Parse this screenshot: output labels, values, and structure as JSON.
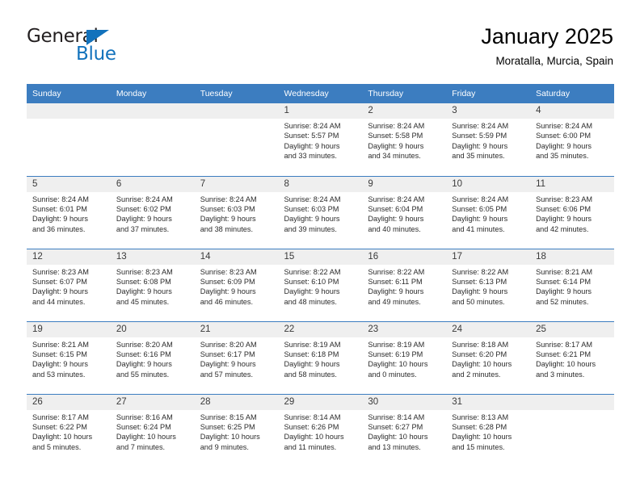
{
  "brand": {
    "name_part1": "General",
    "name_part2": "Blue",
    "logo_icon": "triangle-flag-icon",
    "accent_color": "#1272bc"
  },
  "header": {
    "title": "January 2025",
    "subtitle": "Moratalla, Murcia, Spain"
  },
  "colors": {
    "header_blue": "#3c7dc0",
    "daynum_band": "#efefef",
    "text": "#2b2b2b"
  },
  "calendar": {
    "weekday_headers": [
      "Sunday",
      "Monday",
      "Tuesday",
      "Wednesday",
      "Thursday",
      "Friday",
      "Saturday"
    ],
    "weeks": [
      [
        {
          "day": "",
          "sunrise": "",
          "sunset": "",
          "daylight1": "",
          "daylight2": "",
          "empty": true
        },
        {
          "day": "",
          "sunrise": "",
          "sunset": "",
          "daylight1": "",
          "daylight2": "",
          "empty": true
        },
        {
          "day": "",
          "sunrise": "",
          "sunset": "",
          "daylight1": "",
          "daylight2": "",
          "empty": true
        },
        {
          "day": "1",
          "sunrise": "Sunrise: 8:24 AM",
          "sunset": "Sunset: 5:57 PM",
          "daylight1": "Daylight: 9 hours",
          "daylight2": "and 33 minutes."
        },
        {
          "day": "2",
          "sunrise": "Sunrise: 8:24 AM",
          "sunset": "Sunset: 5:58 PM",
          "daylight1": "Daylight: 9 hours",
          "daylight2": "and 34 minutes."
        },
        {
          "day": "3",
          "sunrise": "Sunrise: 8:24 AM",
          "sunset": "Sunset: 5:59 PM",
          "daylight1": "Daylight: 9 hours",
          "daylight2": "and 35 minutes."
        },
        {
          "day": "4",
          "sunrise": "Sunrise: 8:24 AM",
          "sunset": "Sunset: 6:00 PM",
          "daylight1": "Daylight: 9 hours",
          "daylight2": "and 35 minutes."
        }
      ],
      [
        {
          "day": "5",
          "sunrise": "Sunrise: 8:24 AM",
          "sunset": "Sunset: 6:01 PM",
          "daylight1": "Daylight: 9 hours",
          "daylight2": "and 36 minutes."
        },
        {
          "day": "6",
          "sunrise": "Sunrise: 8:24 AM",
          "sunset": "Sunset: 6:02 PM",
          "daylight1": "Daylight: 9 hours",
          "daylight2": "and 37 minutes."
        },
        {
          "day": "7",
          "sunrise": "Sunrise: 8:24 AM",
          "sunset": "Sunset: 6:03 PM",
          "daylight1": "Daylight: 9 hours",
          "daylight2": "and 38 minutes."
        },
        {
          "day": "8",
          "sunrise": "Sunrise: 8:24 AM",
          "sunset": "Sunset: 6:03 PM",
          "daylight1": "Daylight: 9 hours",
          "daylight2": "and 39 minutes."
        },
        {
          "day": "9",
          "sunrise": "Sunrise: 8:24 AM",
          "sunset": "Sunset: 6:04 PM",
          "daylight1": "Daylight: 9 hours",
          "daylight2": "and 40 minutes."
        },
        {
          "day": "10",
          "sunrise": "Sunrise: 8:24 AM",
          "sunset": "Sunset: 6:05 PM",
          "daylight1": "Daylight: 9 hours",
          "daylight2": "and 41 minutes."
        },
        {
          "day": "11",
          "sunrise": "Sunrise: 8:23 AM",
          "sunset": "Sunset: 6:06 PM",
          "daylight1": "Daylight: 9 hours",
          "daylight2": "and 42 minutes."
        }
      ],
      [
        {
          "day": "12",
          "sunrise": "Sunrise: 8:23 AM",
          "sunset": "Sunset: 6:07 PM",
          "daylight1": "Daylight: 9 hours",
          "daylight2": "and 44 minutes."
        },
        {
          "day": "13",
          "sunrise": "Sunrise: 8:23 AM",
          "sunset": "Sunset: 6:08 PM",
          "daylight1": "Daylight: 9 hours",
          "daylight2": "and 45 minutes."
        },
        {
          "day": "14",
          "sunrise": "Sunrise: 8:23 AM",
          "sunset": "Sunset: 6:09 PM",
          "daylight1": "Daylight: 9 hours",
          "daylight2": "and 46 minutes."
        },
        {
          "day": "15",
          "sunrise": "Sunrise: 8:22 AM",
          "sunset": "Sunset: 6:10 PM",
          "daylight1": "Daylight: 9 hours",
          "daylight2": "and 48 minutes."
        },
        {
          "day": "16",
          "sunrise": "Sunrise: 8:22 AM",
          "sunset": "Sunset: 6:11 PM",
          "daylight1": "Daylight: 9 hours",
          "daylight2": "and 49 minutes."
        },
        {
          "day": "17",
          "sunrise": "Sunrise: 8:22 AM",
          "sunset": "Sunset: 6:13 PM",
          "daylight1": "Daylight: 9 hours",
          "daylight2": "and 50 minutes."
        },
        {
          "day": "18",
          "sunrise": "Sunrise: 8:21 AM",
          "sunset": "Sunset: 6:14 PM",
          "daylight1": "Daylight: 9 hours",
          "daylight2": "and 52 minutes."
        }
      ],
      [
        {
          "day": "19",
          "sunrise": "Sunrise: 8:21 AM",
          "sunset": "Sunset: 6:15 PM",
          "daylight1": "Daylight: 9 hours",
          "daylight2": "and 53 minutes."
        },
        {
          "day": "20",
          "sunrise": "Sunrise: 8:20 AM",
          "sunset": "Sunset: 6:16 PM",
          "daylight1": "Daylight: 9 hours",
          "daylight2": "and 55 minutes."
        },
        {
          "day": "21",
          "sunrise": "Sunrise: 8:20 AM",
          "sunset": "Sunset: 6:17 PM",
          "daylight1": "Daylight: 9 hours",
          "daylight2": "and 57 minutes."
        },
        {
          "day": "22",
          "sunrise": "Sunrise: 8:19 AM",
          "sunset": "Sunset: 6:18 PM",
          "daylight1": "Daylight: 9 hours",
          "daylight2": "and 58 minutes."
        },
        {
          "day": "23",
          "sunrise": "Sunrise: 8:19 AM",
          "sunset": "Sunset: 6:19 PM",
          "daylight1": "Daylight: 10 hours",
          "daylight2": "and 0 minutes."
        },
        {
          "day": "24",
          "sunrise": "Sunrise: 8:18 AM",
          "sunset": "Sunset: 6:20 PM",
          "daylight1": "Daylight: 10 hours",
          "daylight2": "and 2 minutes."
        },
        {
          "day": "25",
          "sunrise": "Sunrise: 8:17 AM",
          "sunset": "Sunset: 6:21 PM",
          "daylight1": "Daylight: 10 hours",
          "daylight2": "and 3 minutes."
        }
      ],
      [
        {
          "day": "26",
          "sunrise": "Sunrise: 8:17 AM",
          "sunset": "Sunset: 6:22 PM",
          "daylight1": "Daylight: 10 hours",
          "daylight2": "and 5 minutes."
        },
        {
          "day": "27",
          "sunrise": "Sunrise: 8:16 AM",
          "sunset": "Sunset: 6:24 PM",
          "daylight1": "Daylight: 10 hours",
          "daylight2": "and 7 minutes."
        },
        {
          "day": "28",
          "sunrise": "Sunrise: 8:15 AM",
          "sunset": "Sunset: 6:25 PM",
          "daylight1": "Daylight: 10 hours",
          "daylight2": "and 9 minutes."
        },
        {
          "day": "29",
          "sunrise": "Sunrise: 8:14 AM",
          "sunset": "Sunset: 6:26 PM",
          "daylight1": "Daylight: 10 hours",
          "daylight2": "and 11 minutes."
        },
        {
          "day": "30",
          "sunrise": "Sunrise: 8:14 AM",
          "sunset": "Sunset: 6:27 PM",
          "daylight1": "Daylight: 10 hours",
          "daylight2": "and 13 minutes."
        },
        {
          "day": "31",
          "sunrise": "Sunrise: 8:13 AM",
          "sunset": "Sunset: 6:28 PM",
          "daylight1": "Daylight: 10 hours",
          "daylight2": "and 15 minutes."
        },
        {
          "day": "",
          "sunrise": "",
          "sunset": "",
          "daylight1": "",
          "daylight2": "",
          "empty": true
        }
      ]
    ]
  }
}
